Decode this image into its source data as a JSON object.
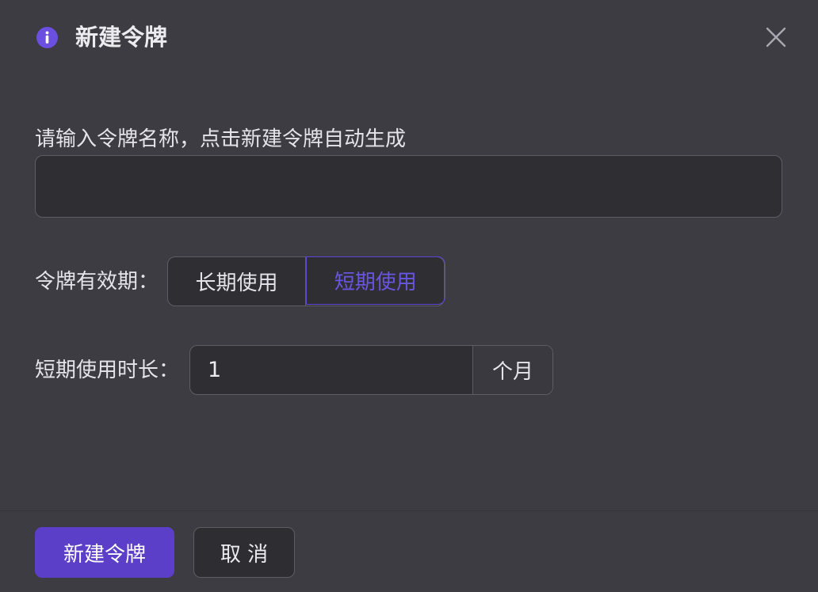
{
  "dialog": {
    "title": "新建令牌",
    "icons": {
      "header": "info-icon",
      "close": "close-icon"
    },
    "accent_color": "#5b45d4"
  },
  "name_field": {
    "label": "请输入令牌名称，点击新建令牌自动生成",
    "value": ""
  },
  "validity": {
    "label": "令牌有效期：",
    "options": [
      "长期使用",
      "短期使用"
    ],
    "selected": "短期使用"
  },
  "duration": {
    "label": "短期使用时长：",
    "value": "1",
    "unit": "个月"
  },
  "footer": {
    "create_label": "新建令牌",
    "cancel_label": "取 消"
  }
}
